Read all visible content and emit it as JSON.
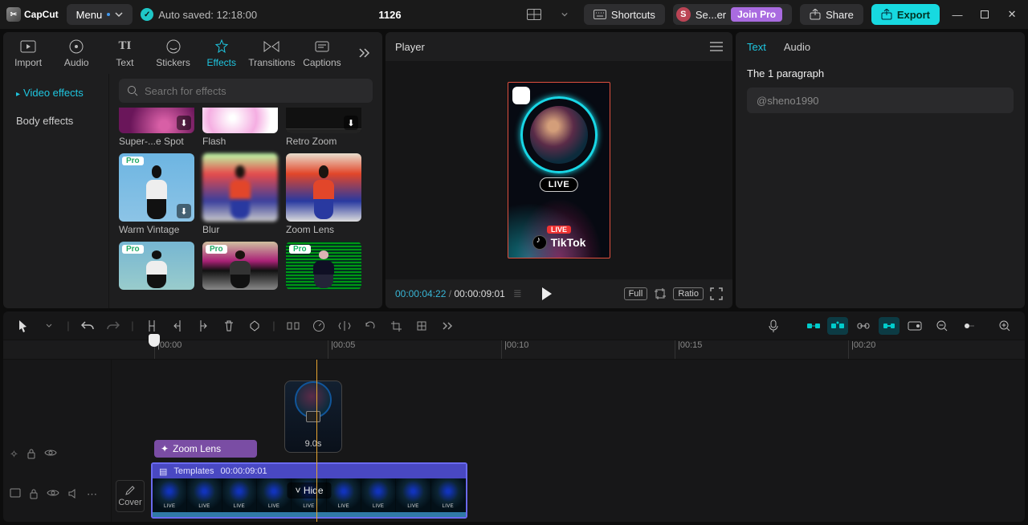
{
  "menubar": {
    "brand": "CapCut",
    "menu": "Menu",
    "autosave": "Auto saved: 12:18:00",
    "center": "1126",
    "shortcuts": "Shortcuts",
    "user": "Se...er",
    "join": "Join Pro",
    "share": "Share",
    "export": "Export"
  },
  "library": {
    "tabs": [
      "Import",
      "Audio",
      "Text",
      "Stickers",
      "Effects",
      "Transitions",
      "Captions"
    ],
    "active_tab": "Effects",
    "side": {
      "video": "Video effects",
      "body": "Body effects"
    },
    "search_ph": "Search for effects",
    "fx": [
      {
        "name": "Super-...e Spot",
        "pro": false,
        "dl": true
      },
      {
        "name": "Flash",
        "pro": false,
        "dl": false
      },
      {
        "name": "Retro Zoom",
        "pro": false,
        "dl": true
      },
      {
        "name": "Warm Vintage",
        "pro": true,
        "dl": true
      },
      {
        "name": "Blur",
        "pro": false,
        "dl": false
      },
      {
        "name": "Zoom Lens",
        "pro": false,
        "dl": false
      },
      {
        "name": "",
        "pro": true,
        "dl": false
      },
      {
        "name": "",
        "pro": true,
        "dl": false
      },
      {
        "name": "",
        "pro": true,
        "dl": false
      }
    ]
  },
  "player": {
    "title": "Player",
    "cur": "00:00:04:22",
    "tot": "00:00:09:01",
    "full": "Full",
    "ratio": "Ratio",
    "preview": {
      "live": "LIVE",
      "live2": "LIVE",
      "tk": "TikTok"
    }
  },
  "inspector": {
    "tabs": [
      "Text",
      "Audio"
    ],
    "active": "Text",
    "heading": "The 1 paragraph",
    "value": "@sheno1990"
  },
  "timeline": {
    "ticks": [
      "00:00",
      "00:05",
      "00:10",
      "00:15",
      "00:20"
    ],
    "ghost_dur": "9.0s",
    "zoom_clip": "Zoom Lens",
    "main_clip": {
      "label": "Templates",
      "dur": "00:00:09:01",
      "hide": "Hide"
    },
    "cover": "Cover"
  }
}
